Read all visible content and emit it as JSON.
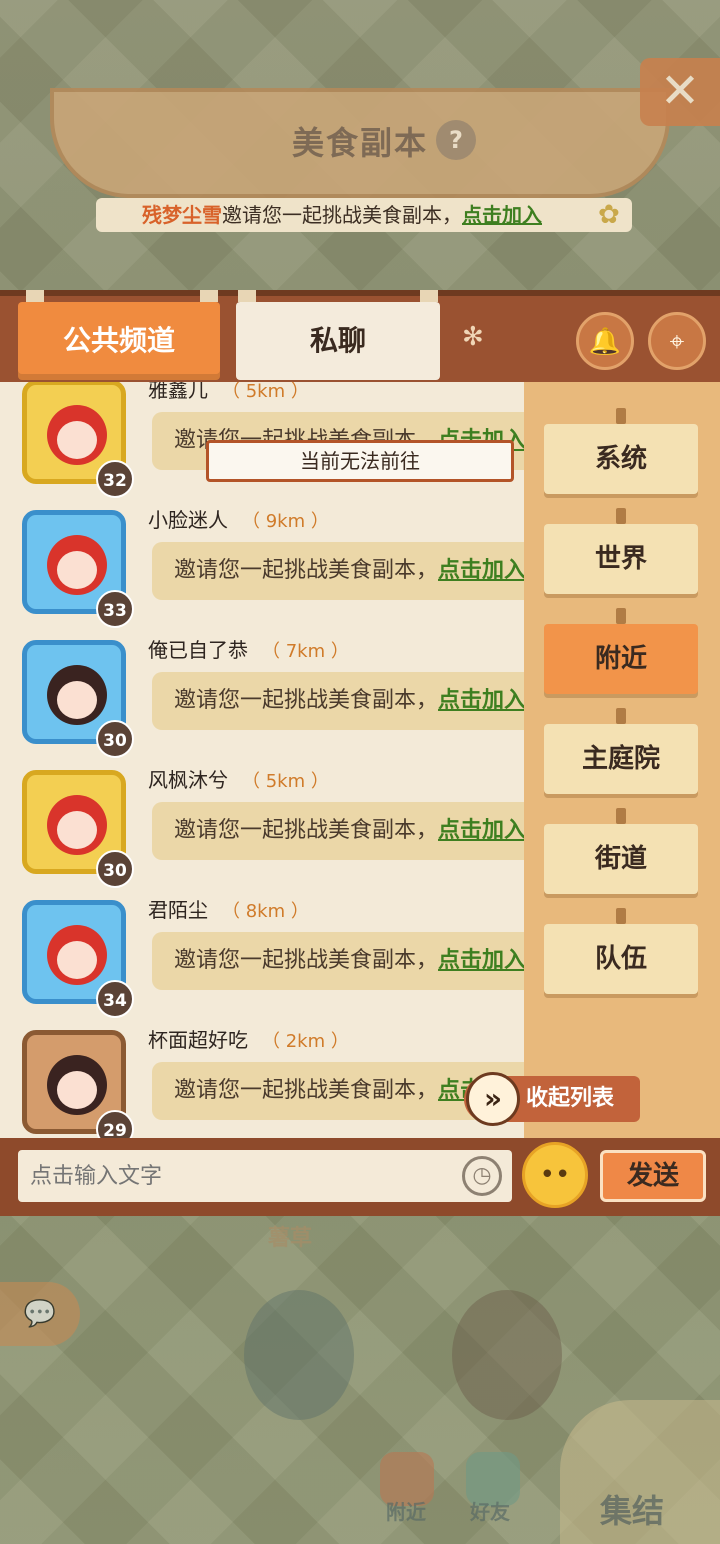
{
  "header": {
    "title": "美食副本",
    "help": "?",
    "close": "✕"
  },
  "invite": {
    "name": "残梦尘雪",
    "text": "邀请您一起挑战美食副本，",
    "join": "点击加入"
  },
  "tabs": {
    "public": "公共频道",
    "private": "私聊"
  },
  "toast": "当前无法前往",
  "messages": [
    {
      "name": "雅鑫儿",
      "dist": "（ 5km ）",
      "level": "32",
      "text": "邀请您一起挑战美食副本，",
      "join": "点击加入"
    },
    {
      "name": "小脸迷人",
      "dist": "（ 9km ）",
      "level": "33",
      "text": "邀请您一起挑战美食副本，",
      "join": "点击加入"
    },
    {
      "name": "俺已自了恭",
      "dist": "（ 7km ）",
      "level": "30",
      "text": "邀请您一起挑战美食副本，",
      "join": "点击加入"
    },
    {
      "name": "风枫沐兮",
      "dist": "（ 5km ）",
      "level": "30",
      "text": "邀请您一起挑战美食副本，",
      "join": "点击加入"
    },
    {
      "name": "君陌尘",
      "dist": "（ 8km ）",
      "level": "34",
      "text": "邀请您一起挑战美食副本，",
      "join": "点击加入"
    },
    {
      "name": "杯面超好吃",
      "dist": "（ 2km ）",
      "level": "29",
      "text": "邀请您一起挑战美食副本，",
      "join": "点击加入"
    }
  ],
  "categories": [
    "系统",
    "世界",
    "附近",
    "主庭院",
    "街道",
    "队伍"
  ],
  "active_category": "附近",
  "collapse": "收起列表",
  "input": {
    "placeholder": "点击输入文字"
  },
  "send": "发送",
  "scene": {
    "label": "薯草",
    "nearby": "附近",
    "friends": "好友",
    "gather": "集结"
  },
  "colors": {
    "accent": "#f08b3f",
    "panel": "#8b4a2b",
    "link": "#3e7f20"
  }
}
